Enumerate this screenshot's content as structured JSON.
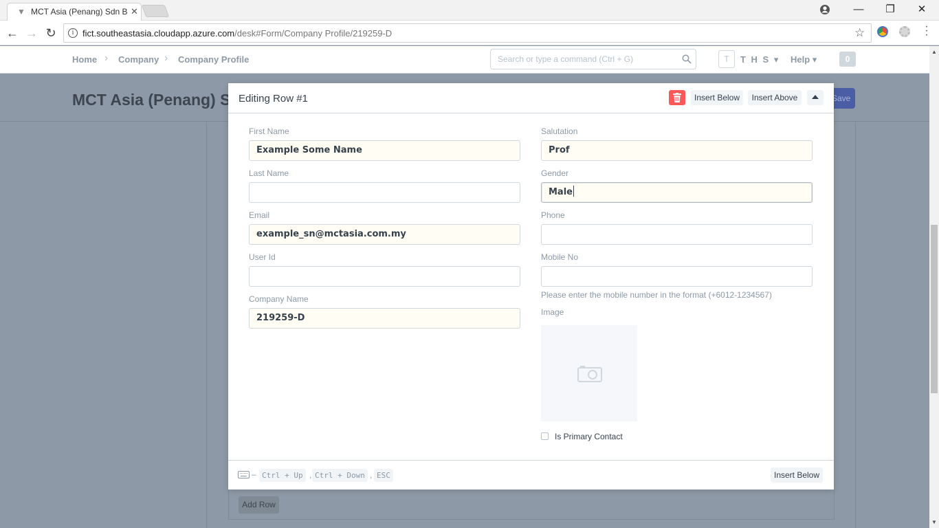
{
  "browser": {
    "tab_title": "MCT Asia (Penang) Sdn B",
    "url_host": "fict.southeastasia.cloudapp.azure.com",
    "url_path": "/desk#Form/Company Profile/219259-D"
  },
  "navbar": {
    "breadcrumbs": [
      "Home",
      "Company",
      "Company Profile"
    ],
    "search_placeholder": "Search or type a command (Ctrl + G)",
    "avatar_initial": "T",
    "user_label": "T H S",
    "help_label": "Help",
    "notification_count": "0"
  },
  "page": {
    "title": "MCT Asia (Penang) Sdn Bhd",
    "save_label": "Save",
    "add_row_label": "Add Row"
  },
  "modal": {
    "title": "Editing Row #1",
    "insert_below_label": "Insert Below",
    "insert_above_label": "Insert Above",
    "fields": {
      "first_name": {
        "label": "First Name",
        "value": "Example Some Name"
      },
      "last_name": {
        "label": "Last Name",
        "value": ""
      },
      "email": {
        "label": "Email",
        "value": "example_sn@mctasia.com.my"
      },
      "user_id": {
        "label": "User Id",
        "value": ""
      },
      "company_name": {
        "label": "Company Name",
        "value": "219259-D"
      },
      "salutation": {
        "label": "Salutation",
        "value": "Prof"
      },
      "gender": {
        "label": "Gender",
        "value": "Male"
      },
      "phone": {
        "label": "Phone",
        "value": ""
      },
      "mobile_no": {
        "label": "Mobile No",
        "value": "",
        "help": "Please enter the mobile number in the format (+6012-1234567)"
      },
      "image": {
        "label": "Image"
      },
      "is_primary_contact": {
        "label": "Is Primary Contact",
        "checked": false
      }
    },
    "footer": {
      "dash": "–",
      "shortcuts": [
        "Ctrl + Up",
        "Ctrl + Down",
        "ESC"
      ],
      "insert_below_label": "Insert Below"
    }
  }
}
